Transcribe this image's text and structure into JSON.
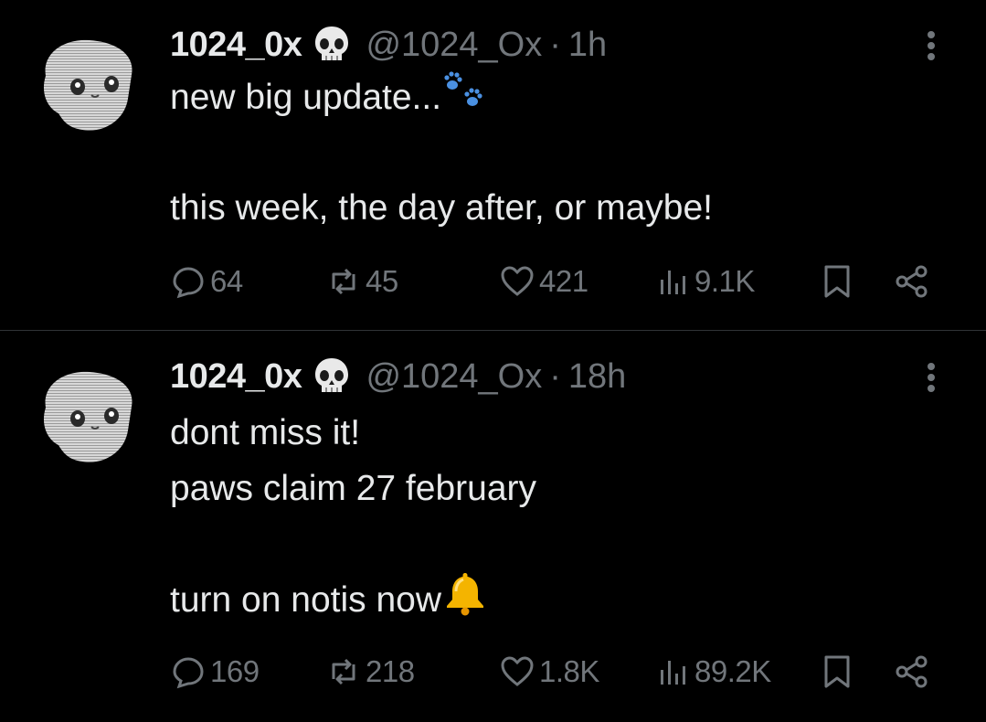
{
  "tweets": [
    {
      "display_name": "1024_0x",
      "badge_icon": "skull-emoji",
      "handle": "@1024_Ox",
      "separator": "·",
      "time": "1h",
      "lines": [
        "new big update...",
        "",
        "this week, the day after, or maybe!"
      ],
      "inline_emoji": "paw-prints-emoji",
      "stats": {
        "replies": "64",
        "reposts": "45",
        "likes": "421",
        "views": "9.1K"
      }
    },
    {
      "display_name": "1024_0x",
      "badge_icon": "skull-emoji",
      "handle": "@1024_Ox",
      "separator": "·",
      "time": "18h",
      "lines": [
        "dont miss it!",
        "paws claim 27 february",
        "",
        "turn on notis now"
      ],
      "inline_emoji": "bell-emoji",
      "stats": {
        "replies": "169",
        "reposts": "218",
        "likes": "1.8K",
        "views": "89.2K"
      }
    }
  ],
  "colors": {
    "background": "#000000",
    "text": "#e7e9ea",
    "muted": "#71767b",
    "divider": "#2f3336"
  }
}
